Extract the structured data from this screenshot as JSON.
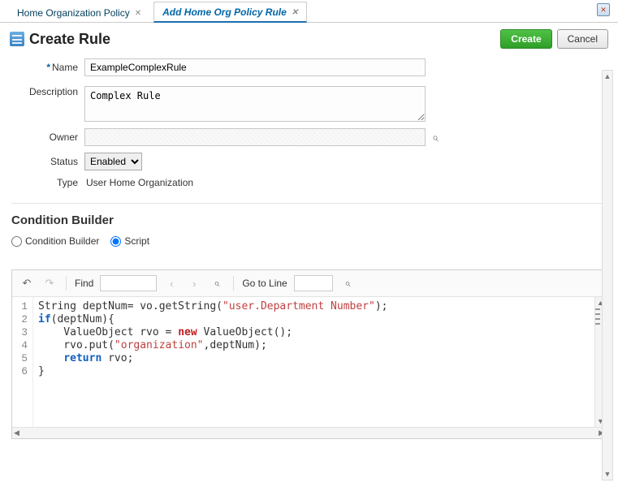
{
  "tabs": [
    {
      "label": "Home Organization Policy",
      "active": false
    },
    {
      "label": "Add Home Org Policy Rule",
      "active": true
    }
  ],
  "header": {
    "title": "Create Rule",
    "create_btn": "Create",
    "cancel_btn": "Cancel"
  },
  "form": {
    "name_label": "Name",
    "name_value": "ExampleComplexRule",
    "description_label": "Description",
    "description_value": "Complex Rule",
    "owner_label": "Owner",
    "owner_value": "",
    "status_label": "Status",
    "status_value": "Enabled",
    "type_label": "Type",
    "type_value": "User Home Organization"
  },
  "condition": {
    "section_title": "Condition Builder",
    "opt_builder": "Condition Builder",
    "opt_script": "Script",
    "selected": "script"
  },
  "toolbar": {
    "find_label": "Find",
    "goto_label": "Go to Line"
  },
  "code_lines": [
    "String deptNum= vo.getString(\"user.Department Number\");",
    "if(deptNum){",
    "    ValueObject rvo = new ValueObject();",
    "    rvo.put(\"organization\",deptNum);",
    "    return rvo;",
    "}"
  ]
}
